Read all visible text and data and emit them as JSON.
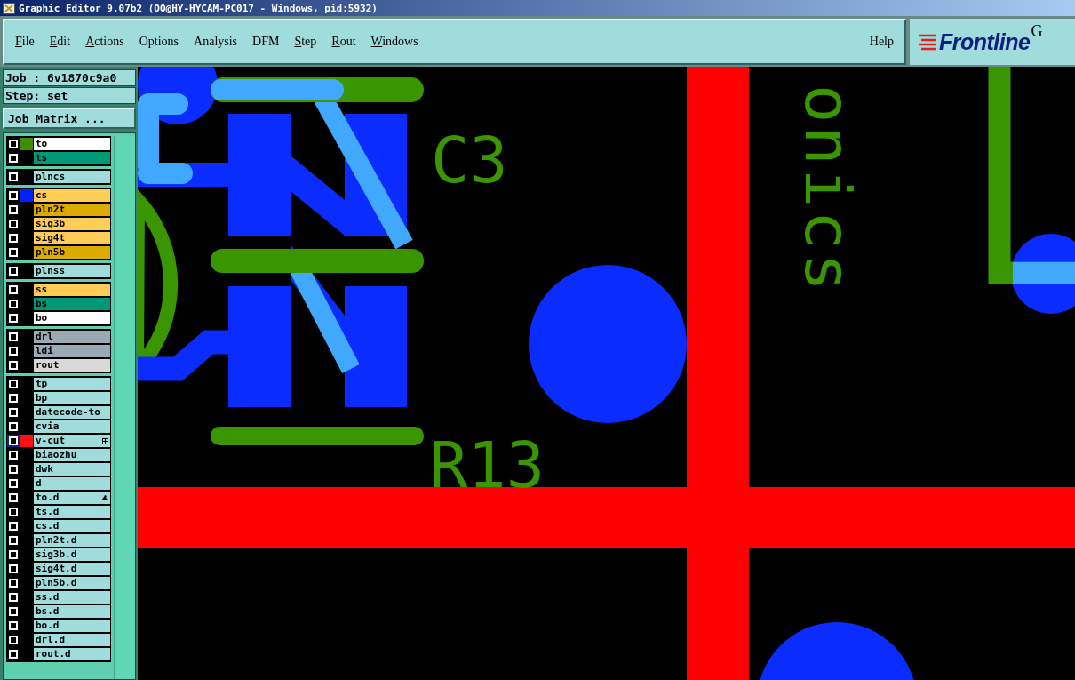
{
  "window": {
    "title": "Graphic Editor 9.07b2 (OO@HY-HYCAM-PC017 - Windows, pid:5932)"
  },
  "menu": [
    {
      "label": "File",
      "underlined": true
    },
    {
      "label": "Edit",
      "underlined": true
    },
    {
      "label": "Actions",
      "underlined": true
    },
    {
      "label": "Options",
      "underlined": false
    },
    {
      "label": "Analysis",
      "underlined": false
    },
    {
      "label": "DFM",
      "underlined": false
    },
    {
      "label": "Step",
      "underlined": true
    },
    {
      "label": "Rout",
      "underlined": true
    },
    {
      "label": "Windows",
      "underlined": true
    }
  ],
  "help": "Help",
  "brand": {
    "name": "Frontline",
    "cut_letter": "G"
  },
  "job": {
    "job": "Job : 6v1870c9a0",
    "step": "Step: set",
    "matrix_button": "Job Matrix ..."
  },
  "layer_groups": [
    [
      {
        "name": "to",
        "kind": "silk_screen",
        "color": "#3f8f00",
        "selected": false,
        "marked": false
      },
      {
        "name": "ts",
        "kind": "solder_mask",
        "selected": false,
        "marked": false
      }
    ],
    [
      {
        "name": "plncs",
        "kind": "document",
        "selected": false,
        "marked": false
      }
    ],
    [
      {
        "name": "cs",
        "kind": "signal",
        "color": "#0022ff",
        "selected": false,
        "marked": false
      },
      {
        "name": "pln2t",
        "kind": "power_ground",
        "selected": false,
        "marked": false
      },
      {
        "name": "sig3b",
        "kind": "signal",
        "selected": false,
        "marked": false
      },
      {
        "name": "sig4t",
        "kind": "signal",
        "selected": false,
        "marked": false
      },
      {
        "name": "pln5b",
        "kind": "power_ground",
        "selected": false,
        "marked": false
      }
    ],
    [
      {
        "name": "plnss",
        "kind": "document",
        "selected": false,
        "marked": false
      }
    ],
    [
      {
        "name": "ss",
        "kind": "signal",
        "selected": false,
        "marked": false
      },
      {
        "name": "bs",
        "kind": "solder_mask",
        "selected": false,
        "marked": false
      },
      {
        "name": "bo",
        "kind": "silk_screen",
        "selected": false,
        "marked": false
      }
    ],
    [
      {
        "name": "drl",
        "kind": "drill",
        "selected": false,
        "marked": false
      },
      {
        "name": "ldi",
        "kind": "drill",
        "selected": false,
        "marked": false
      },
      {
        "name": "rout",
        "kind": "rout",
        "selected": false,
        "marked": false
      }
    ],
    [
      {
        "name": "tp",
        "kind": "document",
        "selected": false,
        "marked": false
      },
      {
        "name": "bp",
        "kind": "document",
        "selected": false,
        "marked": false
      },
      {
        "name": "datecode-to",
        "kind": "document",
        "selected": false,
        "marked": false
      },
      {
        "name": "cvia",
        "kind": "document",
        "selected": false,
        "marked": false
      },
      {
        "name": "v-cut",
        "kind": "document",
        "color": "#ff1111",
        "selected": true,
        "marked": false
      },
      {
        "name": "biaozhu",
        "kind": "document",
        "selected": false,
        "marked": false
      },
      {
        "name": "dwk",
        "kind": "document",
        "selected": false,
        "marked": false
      },
      {
        "name": "d",
        "kind": "document",
        "selected": false,
        "marked": false
      },
      {
        "name": "to.d",
        "kind": "document",
        "selected": false,
        "marked": true
      },
      {
        "name": "ts.d",
        "kind": "document",
        "selected": false,
        "marked": false
      },
      {
        "name": "cs.d",
        "kind": "document",
        "selected": false,
        "marked": false
      },
      {
        "name": "pln2t.d",
        "kind": "document",
        "selected": false,
        "marked": false
      },
      {
        "name": "sig3b.d",
        "kind": "document",
        "selected": false,
        "marked": false
      },
      {
        "name": "sig4t.d",
        "kind": "document",
        "selected": false,
        "marked": false
      },
      {
        "name": "pln5b.d",
        "kind": "document",
        "selected": false,
        "marked": false
      },
      {
        "name": "ss.d",
        "kind": "document",
        "selected": false,
        "marked": false
      },
      {
        "name": "bs.d",
        "kind": "document",
        "selected": false,
        "marked": false
      },
      {
        "name": "bo.d",
        "kind": "document",
        "selected": false,
        "marked": false
      },
      {
        "name": "drl.d",
        "kind": "document",
        "selected": false,
        "marked": false
      },
      {
        "name": "rout.d",
        "kind": "document",
        "selected": false,
        "marked": false
      }
    ]
  ],
  "canvas": {
    "labels": [
      {
        "text": "C3",
        "kind": "horizontal"
      },
      {
        "text": "R13",
        "kind": "horizontal"
      },
      {
        "text": "onics",
        "kind": "vertical"
      }
    ]
  }
}
